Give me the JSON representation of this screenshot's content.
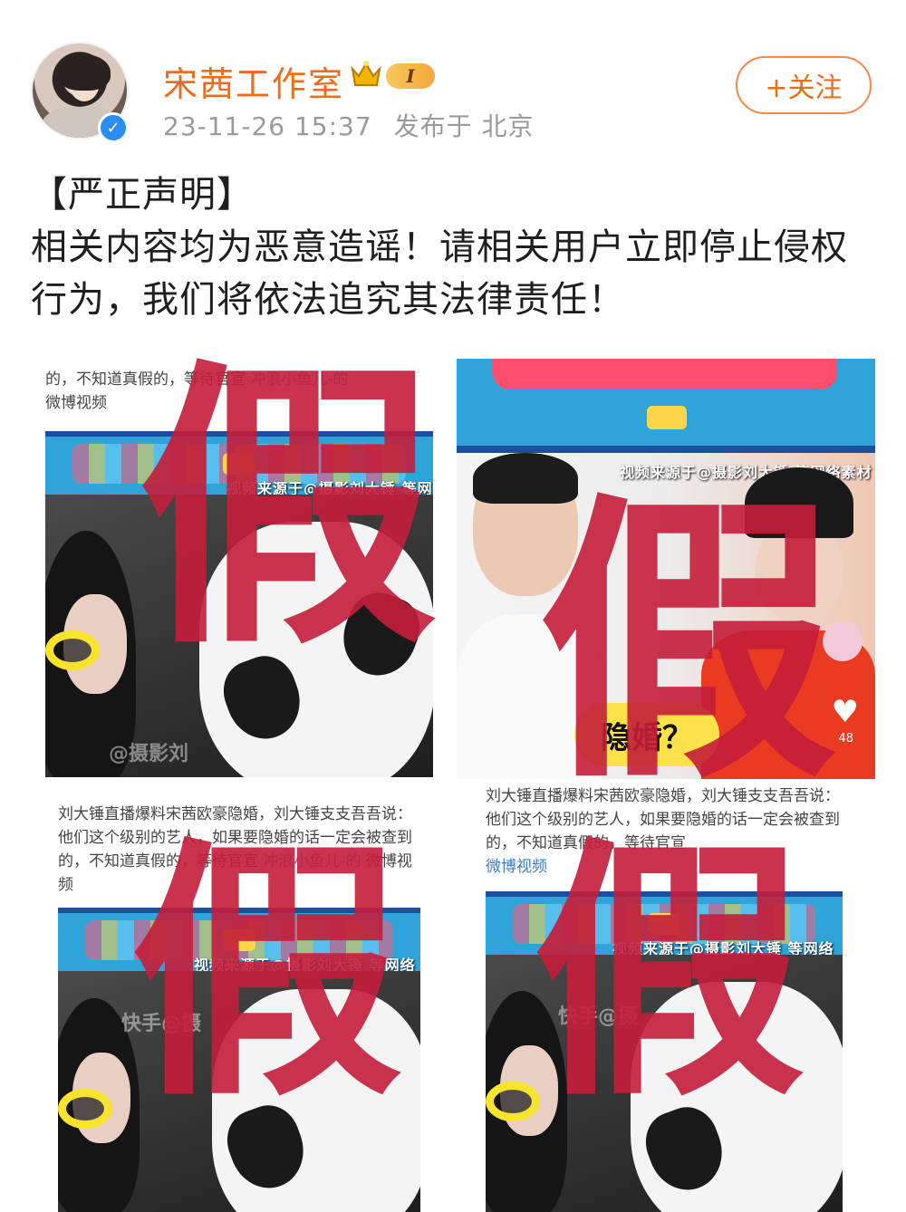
{
  "post": {
    "author": "宋茜工作室",
    "vip_level": "I",
    "time": "23-11-26 15:37",
    "location": "发布于 北京",
    "follow_label": "+关注",
    "title": "【严正声明】",
    "body": "相关内容均为恶意造谣！请相关用户立即停止侵权行为，我们将依法追究其法律责任！"
  },
  "images": {
    "stamp": "假",
    "tile1": {
      "caption_top": "的，不知道真假的，等待官宣",
      "caption_link": "冲浪小鱼儿-的",
      "caption_line3": "微博视频",
      "strip": "视频来源于@摄影刘大锤 等网络素材",
      "watermark": "@摄影刘"
    },
    "tile2": {
      "source": "视频来源于@摄影刘大锤 等网络素材",
      "badge": "隐婚？",
      "likes": "48"
    },
    "tile3": {
      "caption": "刘大锤直播爆料宋茜欧豪隐婚，刘大锤支支吾吾说：他们这个级别的艺人，如果要隐婚的话一定会被查到的，不知道真假的，等待官宣",
      "caption_link": "冲浪小鱼儿-的",
      "caption_end": "微博视频",
      "strip": "视频来源于@摄影刘大锤 等网络素材",
      "watermark": "快手@摄"
    },
    "tile4": {
      "caption": "刘大锤直播爆料宋茜欧豪隐婚，刘大锤支支吾吾说：他们这个级别的艺人，如果要隐婚的话一定会被查到的，不知道真假的，等待官宣",
      "caption_end": "微博视频",
      "strip": "视频来源于@摄影刘大锤 等网络素材",
      "watermark": "快手@摄"
    }
  }
}
